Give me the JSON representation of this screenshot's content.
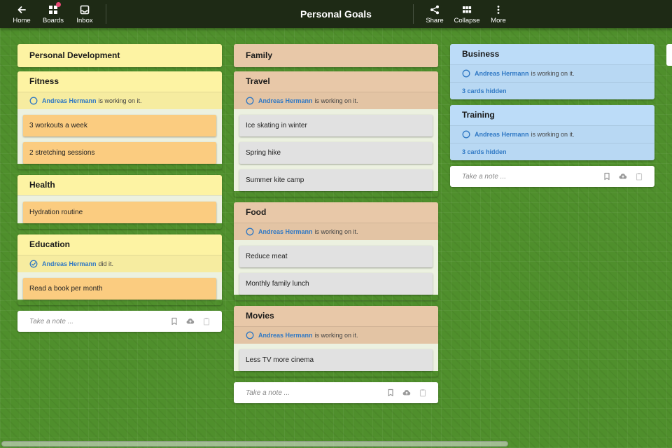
{
  "app": {
    "title": "Personal Goals"
  },
  "nav": {
    "home": "Home",
    "boards": "Boards",
    "inbox": "Inbox",
    "share": "Share",
    "collapse": "Collapse",
    "more": "More"
  },
  "status_text": {
    "working": "is working on it.",
    "done": "did it."
  },
  "note_placeholder": "Take a note ...",
  "columns": [
    {
      "title": "Personal Development",
      "color": "#fdf3a3",
      "groups": [
        {
          "title": "Fitness",
          "status": {
            "user": "Andreas Hermann",
            "state": "working"
          },
          "cards": [
            "3 workouts a week",
            "2 stretching sessions"
          ]
        },
        {
          "title": "Health",
          "cards": [
            "Hydration routine"
          ]
        },
        {
          "title": "Education",
          "status": {
            "user": "Andreas Hermann",
            "state": "done"
          },
          "cards": [
            "Read a book per month"
          ]
        }
      ]
    },
    {
      "title": "Family",
      "color": "#e8c8a8",
      "groups": [
        {
          "title": "Travel",
          "status": {
            "user": "Andreas Hermann",
            "state": "working"
          },
          "cards": [
            "Ice skating in winter",
            "Spring hike",
            "Summer kite camp"
          ]
        },
        {
          "title": "Food",
          "status": {
            "user": "Andreas Hermann",
            "state": "working"
          },
          "cards": [
            "Reduce meat",
            "Monthly family lunch"
          ]
        },
        {
          "title": "Movies",
          "status": {
            "user": "Andreas Hermann",
            "state": "working"
          },
          "cards": [
            "Less TV more cinema"
          ]
        }
      ]
    },
    {
      "title": "Business",
      "color": "#bcdcf8",
      "status": {
        "user": "Andreas Hermann",
        "state": "working"
      },
      "hidden_text": "3 cards hidden",
      "groups": [
        {
          "title": "Training",
          "status": {
            "user": "Andreas Hermann",
            "state": "working"
          },
          "hidden_text": "3 cards hidden"
        }
      ]
    }
  ],
  "colors": {
    "topbar": "#1e2a15",
    "background": "#4f8f2c",
    "accent": "#2f78c4",
    "badge": "#e84a76",
    "card_orange": "#fbcc80",
    "card_gray": "#e1e1e1"
  }
}
